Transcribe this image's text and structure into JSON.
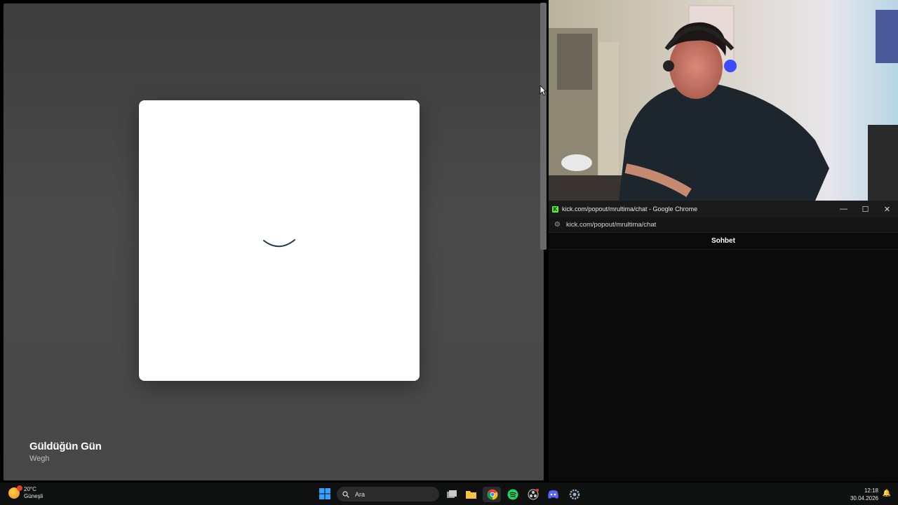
{
  "player": {
    "track_title": "Güldüğün Gün",
    "track_artist": "Wegh"
  },
  "chat_window": {
    "window_title": "kick.com/popout/mrultima/chat - Google Chrome",
    "url": "kick.com/popout/mrultima/chat",
    "chat_header": "Sohbet",
    "controls": {
      "minimize": "—",
      "maximize": "☐",
      "close": "✕"
    }
  },
  "taskbar": {
    "weather_temp": "20°C",
    "weather_desc": "Güneşli",
    "search_placeholder": "Ara",
    "clock_time": "12:18",
    "clock_date": "30.04.2026",
    "apps": [
      "task-view",
      "file-explorer",
      "chrome",
      "spotify",
      "obs",
      "discord",
      "settings"
    ]
  },
  "colors": {
    "kick_green": "#53fc18",
    "taskbar_bg": "#0f1010"
  }
}
